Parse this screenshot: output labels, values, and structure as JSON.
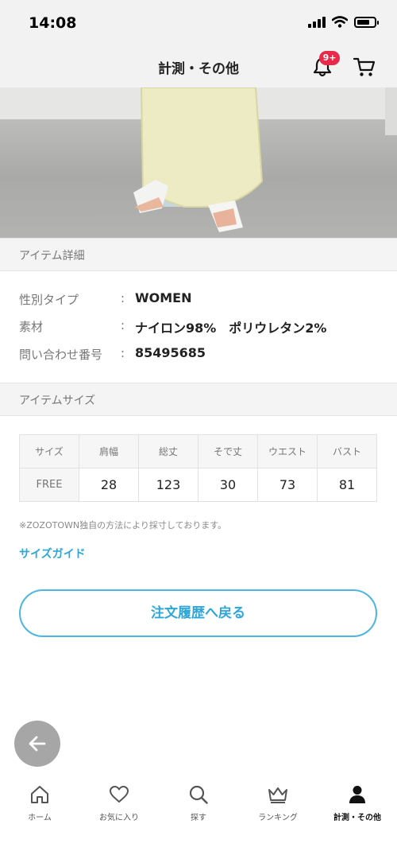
{
  "status_bar": {
    "time": "14:08"
  },
  "nav": {
    "title": "計測・その他",
    "notification_badge": "9+"
  },
  "item_details": {
    "header": "アイテム詳細",
    "rows": [
      {
        "label": "性別タイプ",
        "value": "WOMEN"
      },
      {
        "label": "素材",
        "value": "ナイロン98%　ポリウレタン2%"
      },
      {
        "label": "問い合わせ番号",
        "value": "85495685"
      }
    ]
  },
  "item_size": {
    "header": "アイテムサイズ",
    "columns": [
      "サイズ",
      "肩幅",
      "総丈",
      "そで丈",
      "ウエスト",
      "バスト"
    ],
    "rows": [
      {
        "cells": [
          "FREE",
          "28",
          "123",
          "30",
          "73",
          "81"
        ]
      }
    ],
    "note": "※ZOZOTOWN独自の方法により採寸しております。",
    "guide_link": "サイズガイド"
  },
  "back_to_orders_button": "注文履歴へ戻る",
  "tab_bar": [
    {
      "label": "ホーム",
      "icon": "home-icon",
      "active": false
    },
    {
      "label": "お気に入り",
      "icon": "heart-icon",
      "active": false
    },
    {
      "label": "探す",
      "icon": "search-icon",
      "active": false
    },
    {
      "label": "ランキング",
      "icon": "crown-icon",
      "active": false
    },
    {
      "label": "計測・その他",
      "icon": "person-icon",
      "active": true
    }
  ],
  "colors": {
    "accent": "#2fa6d8",
    "badge": "#e8294a",
    "header_bg": "#f2f2f2"
  }
}
